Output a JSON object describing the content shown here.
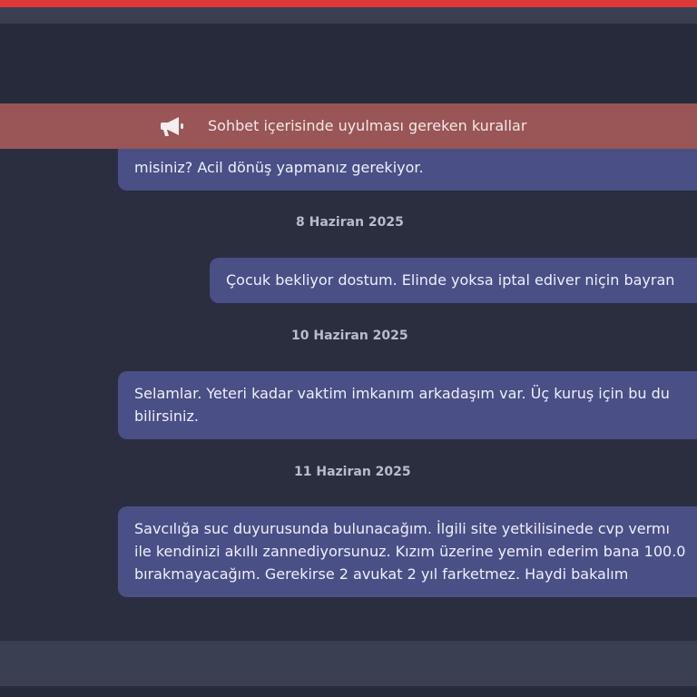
{
  "notice": {
    "icon": "megaphone-icon",
    "text": "Sohbet içerisinde uyulması gereken kurallar"
  },
  "messages": [
    {
      "lines": [
        "misiniz? Acil dönüş yapmanız gerekiyor."
      ]
    },
    {
      "date": "8 Haziran 2025",
      "lines": [
        "Çocuk bekliyor dostum. Elinde yoksa iptal ediver niçin bayran"
      ]
    },
    {
      "date": "10 Haziran 2025",
      "lines": [
        "Selamlar. Yeteri kadar vaktim imkanım arkadaşım var. Üç kuruş için bu du",
        "bilirsiniz."
      ]
    },
    {
      "date": "11 Haziran 2025",
      "lines": [
        "Savcılığa suc duyurusunda bulunacağım. İlgili site yetkilisinede cvp vermı",
        "ile kendinizi akıllı zannediyorsunuz. Kızım üzerine yemin ederim bana 100.0",
        "bırakmayacağım. Gerekirse 2 avukat 2 yıl farketmez. Haydi bakalım"
      ]
    }
  ],
  "colors": {
    "accent": "#e0393b",
    "notice_bg": "#9a5556",
    "bubble_bg": "#4a4f86",
    "page_bg": "#2a2e3f"
  }
}
